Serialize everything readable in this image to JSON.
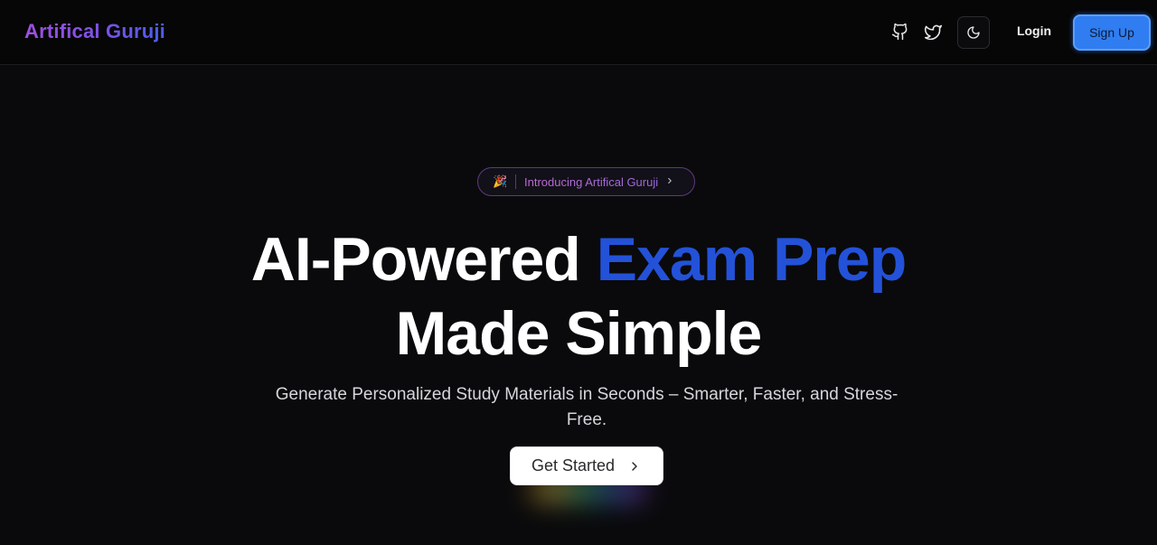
{
  "navbar": {
    "brand": "Artifical Guruji",
    "icons": [
      "github-icon",
      "twitter-icon",
      "moon-icon"
    ],
    "login_label": "Login",
    "signup_label": "Sign Up"
  },
  "hero": {
    "announcement": {
      "emoji": "🎉",
      "text": "Introducing Artifical Guruji",
      "icon": "chevron-right-icon"
    },
    "headline_part1": "AI-Powered ",
    "headline_accent": "Exam Prep",
    "headline_part2": "Made Simple",
    "subtext": "Generate Personalized Study Materials in Seconds – Smarter, Faster, and Stress-Free.",
    "cta_label": "Get Started"
  },
  "colors": {
    "background": "#0a0a0c",
    "accent_blue": "#2352d9",
    "signup_blue": "#2f7df0",
    "brand_purple": "#a04fe0"
  }
}
